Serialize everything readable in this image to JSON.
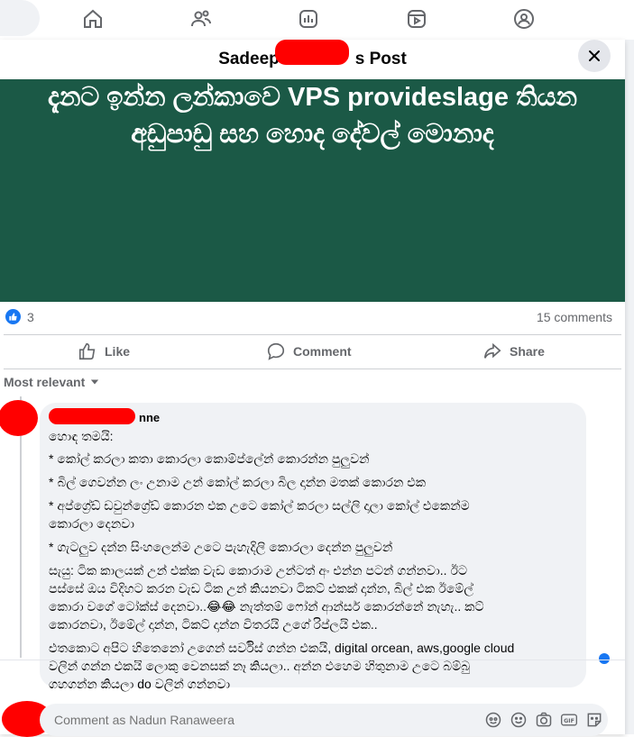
{
  "post": {
    "title_prefix": "Sadeep",
    "title_suffix": "s Post",
    "banner_text": "දැනට ඉන්න ලන්කාවෙ VPS provideslage තියන අඩුපාඩු සහ හොද දේවල් මොනාද",
    "like_count": "3",
    "comments_count": "15 comments"
  },
  "actions": {
    "like": "Like",
    "comment": "Comment",
    "share": "Share"
  },
  "filter": {
    "label": "Most relevant"
  },
  "comment": {
    "author_visible": "nne",
    "lines": [
      "හොඳ තමයි:",
      "* කෝල් කරලා කතා කොරලා කොම්ප්ලේන් කොරන්න පුලුවන්",
      "* බිල් ගෙවන්න ලං උනාම උන් කෝල් කරලා බිල දාන්න මතක් කොරන එක",
      "* අප්ග්‍රේඩ් ඩවුන්ග්‍රේඩ් කොරන එක උටෙ කෝල් කරලා සල්ලි දාලා කෝල් එකෙන්ම",
      "කොරලා දෙනවා",
      "* ගැටලුව දන්න සිංහලෙන්ම උටෙ පැහැදිලි කොරලා දෙන්න පුලුවන්",
      "සැයු: ටික කාලයක් උන් එක්ක වැඩ කොරාම උන්ටත් අං එන්න පටන් ගන්නවා.. ඊට",
      "පස්සේ ඔය විදිහට කරන වැඩ ටික උන් කියනවා ටිකට් එකක් දාන්න, බිල් එක ඊමේල්",
      "කොරා වගේ ටෝක්ස් දෙනවා..😂😂 නැත්තම් ෆෝන් ආන්සර් කොරන්නේ නැහැ.. කට්",
      "කොරනවා, ඊමේල් දාන්න, ටිකට් දාන්න විතරයි උගේ රිප්ලයි එක..",
      "එතකොට අපිට හිතෙනෝ උගෙන් සර්විස් ගන්න එකයි, digital orcean, aws,google cloud",
      "වලින් ගන්න එකයි ලොකු වෙනසක් නෑ කියලා.. අන්න එහෙම හිතුනාම උටෙ බම්බු",
      "ගහගන්න කියලා do වලින් ගන්නවා"
    ]
  },
  "composer": {
    "placeholder": "Comment as Nadun Ranaweera"
  },
  "colors": {
    "banner_bg": "#1b5946",
    "accent": "#1877f2"
  }
}
